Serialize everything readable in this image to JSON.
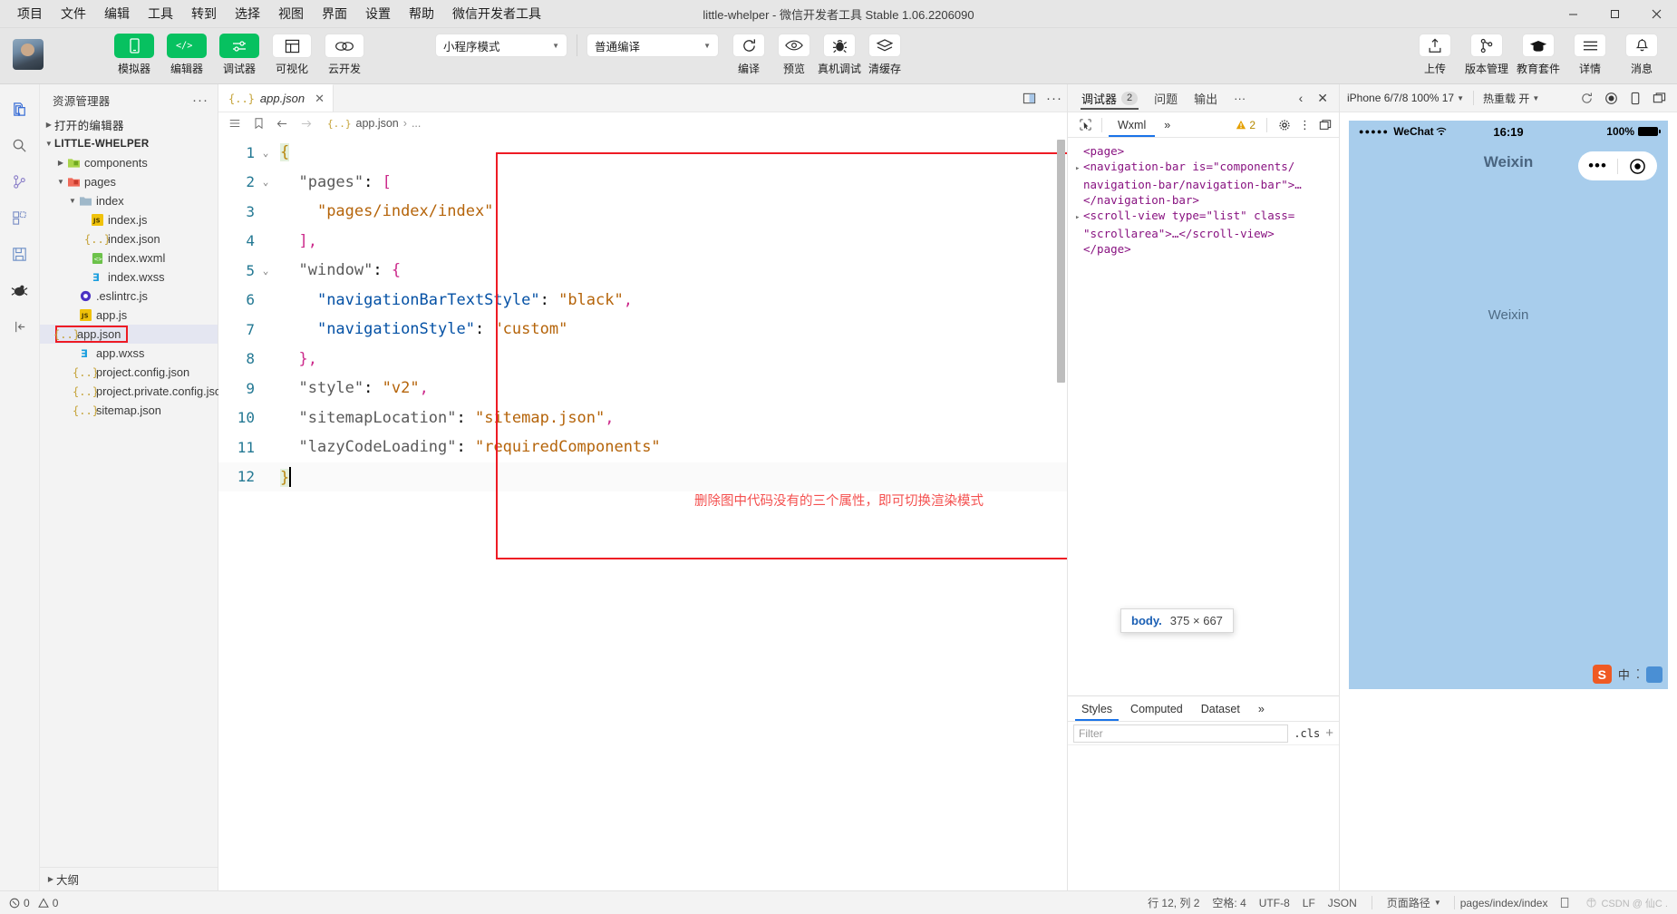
{
  "titlebar": {
    "menus": [
      "项目",
      "文件",
      "编辑",
      "工具",
      "转到",
      "选择",
      "视图",
      "界面",
      "设置",
      "帮助",
      "微信开发者工具"
    ],
    "window_title": "little-whelper - 微信开发者工具 Stable 1.06.2206090",
    "minimize": "—",
    "maximize": "▢",
    "close": "✕"
  },
  "toolbar": {
    "mode_buttons": [
      {
        "label": "模拟器",
        "icon": "phone-icon",
        "style": "green"
      },
      {
        "label": "编辑器",
        "icon": "code-icon",
        "style": "green"
      },
      {
        "label": "调试器",
        "icon": "sliders-icon",
        "style": "green"
      },
      {
        "label": "可视化",
        "icon": "layout-icon",
        "style": "white"
      },
      {
        "label": "云开发",
        "icon": "cloud-icon",
        "style": "white"
      }
    ],
    "compile_mode": "小程序模式",
    "compile_type": "普通编译",
    "action_buttons": [
      {
        "label": "编译",
        "icon": "refresh-icon"
      },
      {
        "label": "预览",
        "icon": "eye-icon"
      },
      {
        "label": "真机调试",
        "icon": "bug-icon"
      },
      {
        "label": "清缓存",
        "icon": "layers-icon"
      }
    ],
    "right_buttons": [
      {
        "label": "上传",
        "icon": "upload-icon"
      },
      {
        "label": "版本管理",
        "icon": "branch-icon"
      },
      {
        "label": "教育套件",
        "icon": "graduation-cap-icon"
      },
      {
        "label": "详情",
        "icon": "menu-icon"
      },
      {
        "label": "消息",
        "icon": "bell-icon"
      }
    ]
  },
  "activity_bar": {
    "icons": [
      "explorer-icon",
      "search-icon",
      "source-control-icon",
      "extensions-icon",
      "save-icon",
      "debug-icon",
      "collapse-icon"
    ]
  },
  "explorer": {
    "title": "资源管理器",
    "more": "···",
    "open_editors": "打开的编辑器",
    "project_name": "LITTLE-WHELPER",
    "tree": [
      {
        "label": "components",
        "indent": 1,
        "twisty": "▸",
        "icon": "folder-components",
        "type": "folder"
      },
      {
        "label": "pages",
        "indent": 1,
        "twisty": "▾",
        "icon": "folder-pages",
        "type": "folder"
      },
      {
        "label": "index",
        "indent": 2,
        "twisty": "▾",
        "icon": "folder",
        "type": "folder"
      },
      {
        "label": "index.js",
        "indent": 3,
        "twisty": "",
        "icon": "js",
        "type": "file"
      },
      {
        "label": "index.json",
        "indent": 3,
        "twisty": "",
        "icon": "json",
        "type": "file"
      },
      {
        "label": "index.wxml",
        "indent": 3,
        "twisty": "",
        "icon": "wxml",
        "type": "file"
      },
      {
        "label": "index.wxss",
        "indent": 3,
        "twisty": "",
        "icon": "wxss",
        "type": "file"
      },
      {
        "label": ".eslintrc.js",
        "indent": 2,
        "twisty": "",
        "icon": "eslint",
        "type": "file"
      },
      {
        "label": "app.js",
        "indent": 2,
        "twisty": "",
        "icon": "js",
        "type": "file"
      },
      {
        "label": "app.json",
        "indent": 2,
        "twisty": "",
        "icon": "json",
        "type": "file",
        "selected": true,
        "highlighted": true
      },
      {
        "label": "app.wxss",
        "indent": 2,
        "twisty": "",
        "icon": "wxss",
        "type": "file"
      },
      {
        "label": "project.config.json",
        "indent": 2,
        "twisty": "",
        "icon": "json",
        "type": "file"
      },
      {
        "label": "project.private.config.json",
        "indent": 2,
        "twisty": "",
        "icon": "json",
        "type": "file"
      },
      {
        "label": "sitemap.json",
        "indent": 2,
        "twisty": "",
        "icon": "json",
        "type": "file"
      }
    ],
    "outline": "大纲"
  },
  "editor": {
    "tab_label": "app.json",
    "tab_close": "✕",
    "breadcrumb_file": "app.json",
    "breadcrumb_sep": "›",
    "breadcrumb_more": "...",
    "split_icon": "split-editor-icon",
    "more_icon": "more-actions-icon",
    "annotation": "删除图中代码没有的三个属性，即可切换渲染模式",
    "lines": [
      {
        "n": "1",
        "fold": "⌄",
        "segs": [
          {
            "t": "{",
            "c": "brace hl-brace"
          }
        ]
      },
      {
        "n": "2",
        "fold": "⌄",
        "segs": [
          {
            "t": "  ",
            "c": ""
          },
          {
            "t": "\"pages\"",
            "c": "k2"
          },
          {
            "t": ": ",
            "c": ""
          },
          {
            "t": "[",
            "c": "punct"
          }
        ]
      },
      {
        "n": "3",
        "fold": "",
        "segs": [
          {
            "t": "    ",
            "c": ""
          },
          {
            "t": "\"pages/index/index\"",
            "c": "str"
          }
        ]
      },
      {
        "n": "4",
        "fold": "",
        "segs": [
          {
            "t": "  ",
            "c": ""
          },
          {
            "t": "]",
            "c": "punct"
          },
          {
            "t": ",",
            "c": "punct"
          }
        ]
      },
      {
        "n": "5",
        "fold": "⌄",
        "segs": [
          {
            "t": "  ",
            "c": ""
          },
          {
            "t": "\"window\"",
            "c": "k2"
          },
          {
            "t": ": ",
            "c": ""
          },
          {
            "t": "{",
            "c": "punct"
          }
        ]
      },
      {
        "n": "6",
        "fold": "",
        "segs": [
          {
            "t": "    ",
            "c": ""
          },
          {
            "t": "\"navigationBarTextStyle\"",
            "c": "k"
          },
          {
            "t": ": ",
            "c": ""
          },
          {
            "t": "\"black\"",
            "c": "str"
          },
          {
            "t": ",",
            "c": "punct"
          }
        ]
      },
      {
        "n": "7",
        "fold": "",
        "segs": [
          {
            "t": "    ",
            "c": ""
          },
          {
            "t": "\"navigationStyle\"",
            "c": "k"
          },
          {
            "t": ": ",
            "c": ""
          },
          {
            "t": "\"custom\"",
            "c": "str"
          }
        ]
      },
      {
        "n": "8",
        "fold": "",
        "segs": [
          {
            "t": "  ",
            "c": ""
          },
          {
            "t": "}",
            "c": "punct"
          },
          {
            "t": ",",
            "c": "punct"
          }
        ]
      },
      {
        "n": "9",
        "fold": "",
        "segs": [
          {
            "t": "  ",
            "c": ""
          },
          {
            "t": "\"style\"",
            "c": "k2"
          },
          {
            "t": ": ",
            "c": ""
          },
          {
            "t": "\"v2\"",
            "c": "str"
          },
          {
            "t": ",",
            "c": "punct"
          }
        ]
      },
      {
        "n": "10",
        "fold": "",
        "segs": [
          {
            "t": "  ",
            "c": ""
          },
          {
            "t": "\"sitemapLocation\"",
            "c": "k2"
          },
          {
            "t": ": ",
            "c": ""
          },
          {
            "t": "\"sitemap.json\"",
            "c": "str"
          },
          {
            "t": ",",
            "c": "punct"
          }
        ]
      },
      {
        "n": "11",
        "fold": "",
        "segs": [
          {
            "t": "  ",
            "c": ""
          },
          {
            "t": "\"lazyCodeLoading\"",
            "c": "k2"
          },
          {
            "t": ": ",
            "c": ""
          },
          {
            "t": "\"requiredComponents\"",
            "c": "str"
          }
        ]
      },
      {
        "n": "12",
        "fold": "",
        "segs": [
          {
            "t": "}",
            "c": "brace hl-brace"
          }
        ]
      }
    ]
  },
  "debugger": {
    "tabs": [
      {
        "label": "调试器",
        "badge": "2",
        "active": true
      },
      {
        "label": "问题",
        "badge": "",
        "active": false
      },
      {
        "label": "输出",
        "badge": "",
        "active": false
      },
      {
        "label": "···",
        "badge": "",
        "active": false
      }
    ],
    "prev_icon": "‹",
    "close_icon": "✕",
    "sub_tabs": [
      {
        "label": "Wxml",
        "active": true
      },
      {
        "label": "»",
        "active": false
      }
    ],
    "inspect_icon": "inspect-icon",
    "warning_count": "2",
    "gear_icon": "gear-icon",
    "kebab_icon": "kebab-icon",
    "dock_icon": "dock-icon",
    "dom": [
      {
        "indent": 0,
        "arrow": "",
        "html": "&lt;page&gt;"
      },
      {
        "indent": 0,
        "arrow": "▸",
        "html": "&lt;navigation-bar is=\"components/"
      },
      {
        "indent": 0,
        "arrow": "",
        "html": "navigation-bar/navigation-bar\"&gt;…"
      },
      {
        "indent": 0,
        "arrow": "",
        "html": "&lt;/navigation-bar&gt;"
      },
      {
        "indent": 0,
        "arrow": "▸",
        "html": "&lt;scroll-view type=\"list\" class="
      },
      {
        "indent": 0,
        "arrow": "",
        "html": "\"scrollarea\"&gt;…&lt;/scroll-view&gt;"
      },
      {
        "indent": 0,
        "arrow": "",
        "html": "&lt;/page&gt;"
      }
    ],
    "styles_tabs": [
      {
        "label": "Styles",
        "active": true
      },
      {
        "label": "Computed",
        "active": false
      },
      {
        "label": "Dataset",
        "active": false
      },
      {
        "label": "»",
        "active": false
      }
    ],
    "filter_placeholder": "Filter",
    "cls_label": ".cls",
    "plus_label": "+"
  },
  "simulator": {
    "device": "iPhone 6/7/8 100% 17",
    "hot_reload": "热重载 开",
    "icons": [
      "rotate-icon",
      "record-icon",
      "device-icon",
      "window-icon"
    ],
    "phone": {
      "carrier": "WeChat",
      "signal_dots": "●●●●●",
      "wifi_icon": "wifi-icon",
      "time": "16:19",
      "battery_pct": "100%",
      "nav_title": "Weixin",
      "capsule_dots": "•••",
      "capsule_target": "target-icon",
      "page_text": "Weixin",
      "ime": {
        "s": "S",
        "text": "中",
        "dot": "⁚",
        "panel": "ime-panel-icon"
      }
    },
    "tooltip": {
      "selector": "body.",
      "size": "375 × 667"
    }
  },
  "statusbar": {
    "errors": "0",
    "warnings": "0",
    "error_icon": "error-circle-icon",
    "warning_icon": "warning-triangle-icon",
    "line_col": "行 12, 列 2",
    "spaces": "空格: 4",
    "encoding": "UTF-8",
    "eol": "LF",
    "language": "JSON",
    "page_path_label": "页面路径",
    "page_path": "pages/index/index",
    "copy_icon": "copy-icon",
    "watermark": "CSDN @ 仙C ."
  }
}
